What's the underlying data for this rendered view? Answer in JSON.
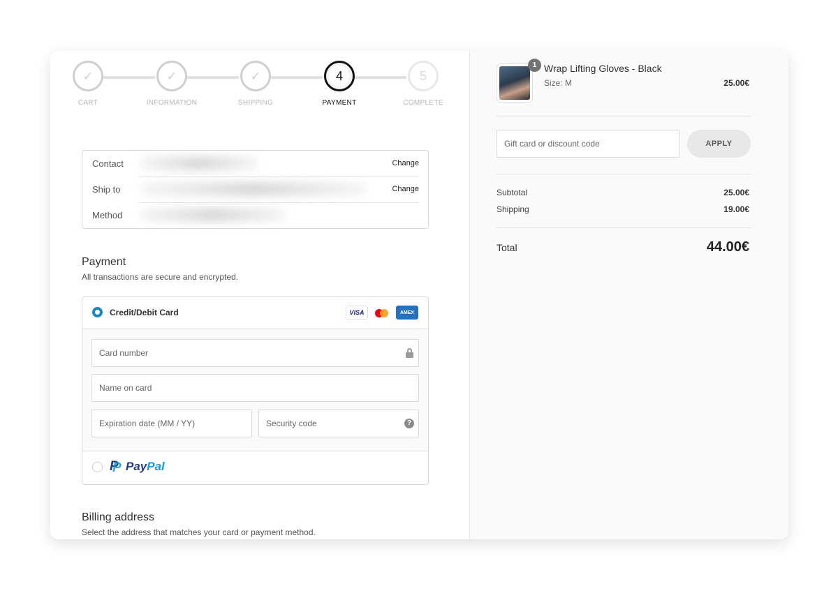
{
  "steps": [
    {
      "label": "CART",
      "state": "done",
      "mark": "✓"
    },
    {
      "label": "INFORMATION",
      "state": "done",
      "mark": "✓"
    },
    {
      "label": "SHIPPING",
      "state": "done",
      "mark": "✓"
    },
    {
      "label": "PAYMENT",
      "state": "active",
      "mark": "4"
    },
    {
      "label": "COMPLETE",
      "state": "future",
      "mark": "5"
    }
  ],
  "review": {
    "contact_label": "Contact",
    "ship_label": "Ship to",
    "method_label": "Method",
    "change_label": "Change"
  },
  "payment": {
    "title": "Payment",
    "subtitle": "All transactions are secure and encrypted.",
    "card_option": "Credit/Debit Card",
    "brands": {
      "visa": "VISA",
      "amex": "AMEX"
    },
    "card_number_ph": "Card number",
    "name_ph": "Name on card",
    "expiry_ph": "Expiration date (MM / YY)",
    "security_ph": "Security code",
    "help_glyph": "?",
    "paypal": {
      "pay": "Pay",
      "pal": "Pal",
      "mark": "P"
    }
  },
  "billing": {
    "title": "Billing address",
    "subtitle": "Select the address that matches your card or payment method."
  },
  "summary": {
    "product": {
      "name": "Wrap Lifting Gloves - Black",
      "variant": "Size: M",
      "price": "25.00€",
      "quantity": "1"
    },
    "discount_ph": "Gift card or discount code",
    "apply_label": "APPLY",
    "subtotal_label": "Subtotal",
    "subtotal": "25.00€",
    "shipping_label": "Shipping",
    "shipping": "19.00€",
    "total_label": "Total",
    "total": "44.00€"
  },
  "colors": {
    "accent_radio": "#1a86c8",
    "amex_blue": "#2671b9",
    "paypal_dark": "#253b80",
    "paypal_light": "#179bd7"
  }
}
